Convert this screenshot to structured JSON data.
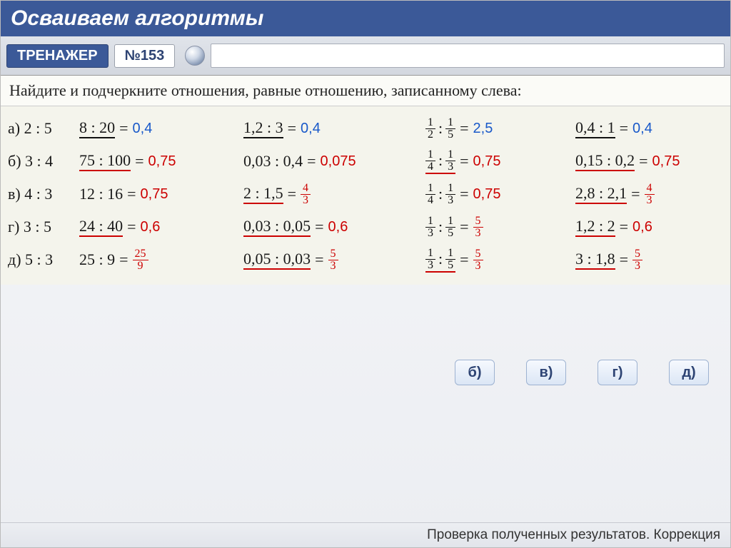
{
  "header": {
    "title": "Осваиваем алгоритмы"
  },
  "toolbar": {
    "trainer": "ТРЕНАЖЕР",
    "number": "№153"
  },
  "instruction": "Найдите и подчеркните отношения, равные отношению, записанному слева:",
  "rows": {
    "a": {
      "label": "а) 2 : 5",
      "c1_ratio": "8 : 20",
      "c1_ans": "0,4",
      "c2_ratio": "1,2 : 3",
      "c2_ans": "0,4",
      "c3_l_n": "1",
      "c3_l_d": "2",
      "c3_r_n": "1",
      "c3_r_d": "5",
      "c3_ans": "2,5",
      "c4_ratio": "0,4 : 1",
      "c4_ans": "0,4"
    },
    "b": {
      "label": "б) 3 : 4",
      "c1_ratio": "75 : 100",
      "c1_ans": "0,75",
      "c2_ratio": "0,03 : 0,4",
      "c2_ans": "0,075",
      "c3_l_n": "1",
      "c3_l_d": "4",
      "c3_r_n": "1",
      "c3_r_d": "3",
      "c3_ans": "0,75",
      "c4_ratio": "0,15 : 0,2",
      "c4_ans": "0,75"
    },
    "v": {
      "label": "в) 4 : 3",
      "c1_ratio": "12 : 16",
      "c1_ans": "0,75",
      "c2_ratio": "2 : 1,5",
      "c2_fn": "4",
      "c2_fd": "3",
      "c3_l_n": "1",
      "c3_l_d": "4",
      "c3_r_n": "1",
      "c3_r_d": "3",
      "c3_ans": "0,75",
      "c4_ratio": "2,8 : 2,1",
      "c4_fn": "4",
      "c4_fd": "3"
    },
    "g": {
      "label": "г) 3 : 5",
      "c1_ratio": "24 : 40",
      "c1_ans": "0,6",
      "c2_ratio": "0,03 : 0,05",
      "c2_ans": "0,6",
      "c3_l_n": "1",
      "c3_l_d": "3",
      "c3_r_n": "1",
      "c3_r_d": "5",
      "c3_fn": "5",
      "c3_fd": "3",
      "c4_ratio": "1,2 : 2",
      "c4_ans": "0,6"
    },
    "d": {
      "label": "д) 5 : 3",
      "c1_ratio": "25 : 9",
      "c1_fn": "25",
      "c1_fd": "9",
      "c2_ratio": "0,05 : 0,03",
      "c2_fn": "5",
      "c2_fd": "3",
      "c3_l_n": "1",
      "c3_l_d": "3",
      "c3_r_n": "1",
      "c3_r_d": "5",
      "c3_fn": "5",
      "c3_fd": "3",
      "c4_ratio": "3 : 1,8",
      "c4_fn": "5",
      "c4_fd": "3"
    }
  },
  "buttons": {
    "b": "б)",
    "v": "в)",
    "g": "г)",
    "d": "д)"
  },
  "footer": "Проверка полученных результатов. Коррекция",
  "sym": {
    "eq": "=",
    "colon": ":"
  }
}
